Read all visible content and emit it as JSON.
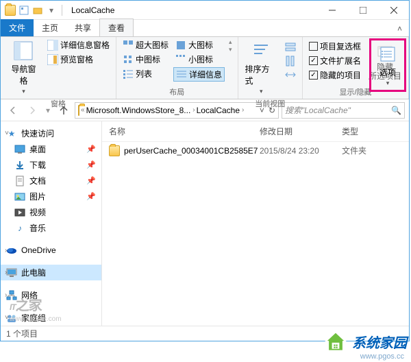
{
  "titlebar": {
    "title": "LocalCache"
  },
  "tabs": {
    "file": "文件",
    "home": "主页",
    "share": "共享",
    "view": "查看"
  },
  "ribbon": {
    "panes": {
      "nav": "导航窗格",
      "detail": "详细信息窗格",
      "preview": "预览窗格",
      "group": "窗格"
    },
    "layout": {
      "xl": "超大图标",
      "lg": "大图标",
      "md": "中图标",
      "sm": "小图标",
      "list": "列表",
      "details": "详细信息",
      "group": "布局"
    },
    "current": {
      "sort": "排序方式",
      "group": "当前视图"
    },
    "showhide": {
      "itemcheck": "项目复选框",
      "ext": "文件扩展名",
      "hidden": "隐藏的项目",
      "hidebtn": "隐藏\n所选项目",
      "group": "显示/隐藏"
    },
    "options": "选项"
  },
  "address": {
    "crumb1": "Microsoft.WindowsStore_8...",
    "crumb2": "LocalCache"
  },
  "search": {
    "placeholder": "搜索\"LocalCache\""
  },
  "nav": {
    "quick": "快速访问",
    "desktop": "桌面",
    "downloads": "下载",
    "documents": "文档",
    "pictures": "图片",
    "videos": "视频",
    "music": "音乐",
    "onedrive": "OneDrive",
    "thispc": "此电脑",
    "network": "网络",
    "homegroup": "家庭组"
  },
  "columns": {
    "name": "名称",
    "date": "修改日期",
    "type": "类型"
  },
  "items": [
    {
      "name": "perUserCache_00034001CB2585E7",
      "date": "2015/8/24 23:20",
      "type": "文件夹"
    }
  ],
  "status": {
    "count": "1 个项目"
  },
  "watermark": {
    "brand": "IT之家",
    "url": "www.ithome.com"
  },
  "logo": {
    "text": "系统家园",
    "url": "www.pgos.cc"
  }
}
